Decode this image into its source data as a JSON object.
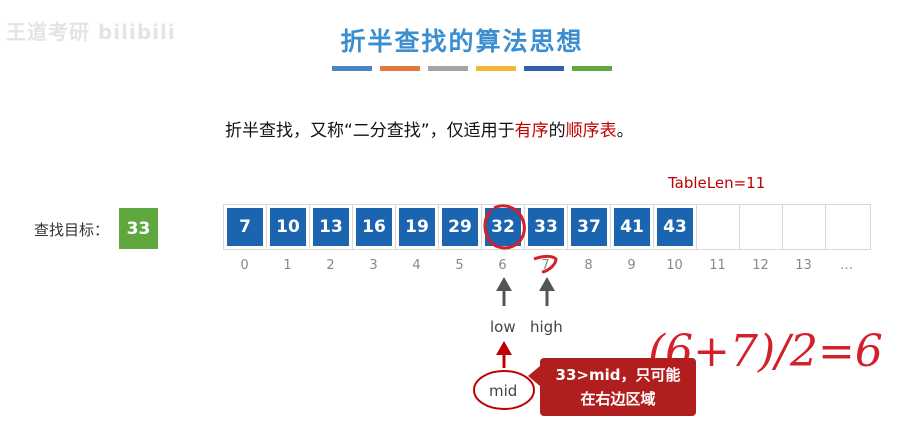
{
  "watermark": "王道考研 bilibili",
  "title": "折半查找的算法思想",
  "title_bar_colors": [
    "#4a86c5",
    "#e07b39",
    "#a5a5a5",
    "#f2b830",
    "#2e5fa8",
    "#5fa840"
  ],
  "subtitle": {
    "prefix": "折半查找，又称“二分查找”，仅适用于",
    "ordered": "有序",
    "de": "的",
    "seq_table": "顺序表",
    "suffix": "。"
  },
  "table_len": "TableLen=11",
  "target_label": "查找目标：",
  "target_value": "33",
  "array": {
    "values": [
      "7",
      "10",
      "13",
      "16",
      "19",
      "29",
      "32",
      "33",
      "37",
      "41",
      "43",
      "",
      "",
      "",
      ""
    ],
    "indices": [
      "0",
      "1",
      "2",
      "3",
      "4",
      "5",
      "6",
      "7",
      "8",
      "9",
      "10",
      "11",
      "12",
      "13",
      "…"
    ]
  },
  "pointers": {
    "low": "low",
    "high": "high",
    "mid": "mid"
  },
  "callout": {
    "line1": "33>mid，只可能",
    "line2": "在右边区域"
  },
  "handwriting": "(6+7)/2=6",
  "colors": {
    "accent_blue": "#3b8ed0",
    "cell_blue": "#1a64b0",
    "target_green": "#5fa840",
    "highlight_red": "#c00000"
  }
}
